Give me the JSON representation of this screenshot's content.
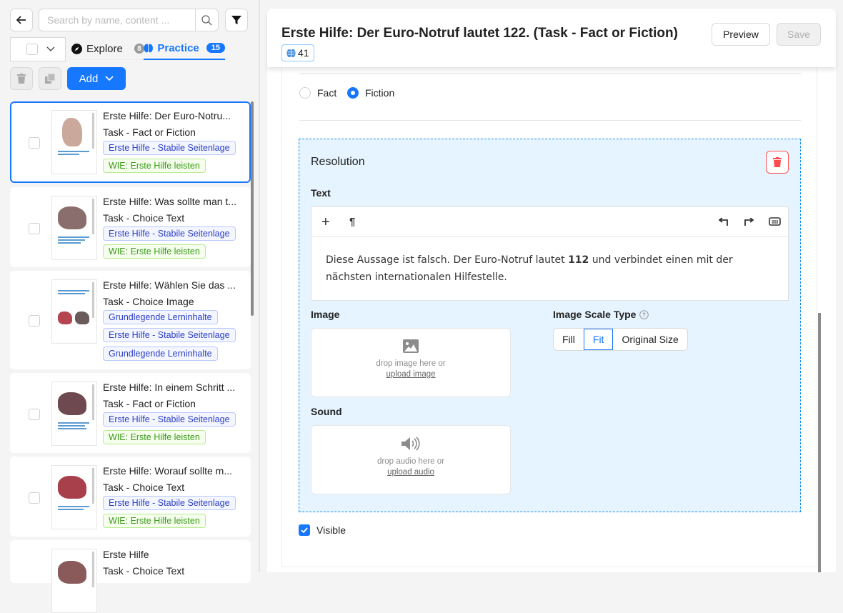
{
  "sidebar": {
    "search_placeholder": "Search by name, content ...",
    "tabs": [
      {
        "label": "Explore",
        "count": "8",
        "icon": "compass-icon",
        "active": false
      },
      {
        "label": "Practice",
        "count": "15",
        "icon": "brain-icon",
        "active": true
      }
    ],
    "add_label": "Add",
    "items": [
      {
        "title": "Erste Hilfe: Der Euro-Notru...",
        "type": "Task - Fact or Fiction",
        "tags": [
          {
            "label": "Erste Hilfe - Stabile Seitenlage",
            "color": "blue"
          },
          {
            "label": "WIE: Erste Hilfe leisten",
            "color": "green"
          }
        ],
        "selected": true
      },
      {
        "title": "Erste Hilfe: Was sollte man t...",
        "type": "Task - Choice Text",
        "tags": [
          {
            "label": "Erste Hilfe - Stabile Seitenlage",
            "color": "blue"
          },
          {
            "label": "WIE: Erste Hilfe leisten",
            "color": "green"
          }
        ],
        "selected": false
      },
      {
        "title": "Erste Hilfe: Wählen Sie das ...",
        "type": "Task - Choice Image",
        "tags": [
          {
            "label": "Grundlegende Lerninhalte",
            "color": "blue"
          },
          {
            "label": "Erste Hilfe - Stabile Seitenlage",
            "color": "blue"
          },
          {
            "label": "Grundlegende Lerninhalte",
            "color": "blue"
          }
        ],
        "selected": false
      },
      {
        "title": "Erste Hilfe: In einem Schritt ...",
        "type": "Task - Fact or Fiction",
        "tags": [
          {
            "label": "Erste Hilfe - Stabile Seitenlage",
            "color": "blue"
          },
          {
            "label": "WIE: Erste Hilfe leisten",
            "color": "green"
          }
        ],
        "selected": false
      },
      {
        "title": "Erste Hilfe: Worauf sollte m...",
        "type": "Task - Choice Text",
        "tags": [
          {
            "label": "Erste Hilfe - Stabile Seitenlage",
            "color": "blue"
          },
          {
            "label": "WIE: Erste Hilfe leisten",
            "color": "green"
          }
        ],
        "selected": false
      },
      {
        "title": "Erste Hilfe",
        "type": "Task - Choice Text",
        "tags": [],
        "selected": false
      }
    ]
  },
  "header": {
    "title": "Erste Hilfe: Der Euro-Notruf lautet 122. (Task - Fact or Fiction)",
    "badge_count": "41",
    "preview_label": "Preview",
    "save_label": "Save"
  },
  "editor": {
    "options": [
      {
        "label": "Fact",
        "checked": false
      },
      {
        "label": "Fiction",
        "checked": true
      }
    ],
    "resolution": {
      "title": "Resolution",
      "text_label": "Text",
      "text_before": "Diese Aussage ist falsch. Der Euro-Notruf lautet ",
      "text_bold": "112",
      "text_after": " und verbindet einen mit der nächsten internationalen Hilfestelle.",
      "image_label": "Image",
      "image_drop": "drop image here or",
      "image_upload": "upload image",
      "scale_label": "Image Scale Type",
      "scale_options": [
        "Fill",
        "Fit",
        "Original Size"
      ],
      "scale_selected": "Fit",
      "sound_label": "Sound",
      "sound_drop": "drop audio here or",
      "sound_upload": "upload audio"
    },
    "visible_label": "Visible",
    "visible_checked": true
  },
  "colors": {
    "accent": "#1677ff",
    "danger": "#ff4d4f",
    "resolution_bg": "#e6f4ff"
  }
}
